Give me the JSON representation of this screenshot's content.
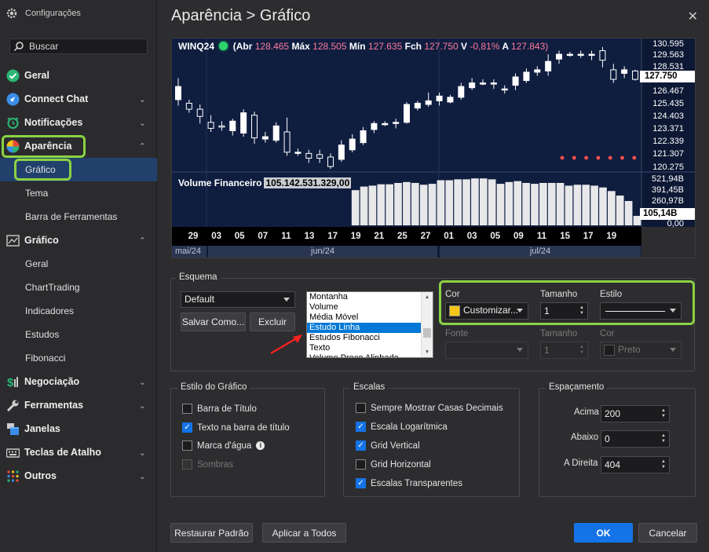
{
  "sidebar": {
    "header": "Configurações",
    "search_placeholder": "Buscar",
    "items": [
      {
        "label": "Geral",
        "icon": "check-circle-icon",
        "expandable": false
      },
      {
        "label": "Connect Chat",
        "icon": "chat-icon",
        "expandable": true
      },
      {
        "label": "Notificações",
        "icon": "alarm-icon",
        "expandable": true
      },
      {
        "label": "Aparência",
        "icon": "palette-icon",
        "expandable": true,
        "expanded": true
      },
      {
        "label": "Gráfico",
        "icon": "chart-icon",
        "expandable": true,
        "expanded": true
      },
      {
        "label": "Negociação",
        "icon": "dollar-icon",
        "expandable": true
      },
      {
        "label": "Ferramentas",
        "icon": "wrench-icon",
        "expandable": true
      },
      {
        "label": "Janelas",
        "icon": "windows-icon",
        "expandable": false
      },
      {
        "label": "Teclas de Atalho",
        "icon": "keyboard-icon",
        "expandable": true
      },
      {
        "label": "Outros",
        "icon": "dots-grid-icon",
        "expandable": true
      }
    ],
    "aparencia_sub": [
      "Gráfico",
      "Tema",
      "Barra de Ferramentas"
    ],
    "grafico_sub": [
      "Geral",
      "ChartTrading",
      "Indicadores",
      "Estudos",
      "Fibonacci"
    ]
  },
  "page": {
    "title": "Aparência > Gráfico"
  },
  "chart": {
    "symbol": "WINQ24",
    "abr_label": "(Abr",
    "abr": "128.465",
    "max_label": "Máx",
    "max": "128.505",
    "min_label": "Mín",
    "min": "127.635",
    "fch_label": "Fch",
    "fch": "127.750",
    "var_label": "V",
    "var": "-0,81%",
    "a_label": "A",
    "a": "127.843)",
    "price_ticks": [
      "130.595",
      "129.563",
      "128.531",
      "126.467",
      "125.435",
      "124.403",
      "123.371",
      "122.339",
      "121.307",
      "120.275"
    ],
    "last_price": "127.750",
    "volume_label": "Volume Financeiro",
    "volume_value": "105.142.531.329,00",
    "volume_ticks": [
      "521,94B",
      "391,45B",
      "260,97B",
      "0,00"
    ],
    "last_volume": "105,14B",
    "x_labels": [
      "29",
      "03",
      "05",
      "07",
      "11",
      "13",
      "17",
      "19",
      "21",
      "25",
      "27",
      "01",
      "03",
      "05",
      "09",
      "11",
      "15",
      "17",
      "19"
    ],
    "months": [
      "mai/24",
      "jun/24",
      "jul/24"
    ],
    "colors": {
      "background": "#0e1a36",
      "candle": "#ffffff",
      "volume": "#e8e8ea",
      "marker": "#ff4d4d"
    }
  },
  "chart_data": {
    "type": "candlestick",
    "title": "WINQ24",
    "candles": [
      {
        "o": 126.0,
        "c": 127.1,
        "h": 127.8,
        "l": 125.5
      },
      {
        "o": 125.7,
        "c": 125.2,
        "h": 126.0,
        "l": 124.9
      },
      {
        "o": 125.2,
        "c": 124.6,
        "h": 125.6,
        "l": 124.0
      },
      {
        "o": 124.1,
        "c": 123.6,
        "h": 124.7,
        "l": 123.3
      },
      {
        "o": 123.8,
        "c": 123.7,
        "h": 124.2,
        "l": 123.4
      },
      {
        "o": 123.4,
        "c": 124.2,
        "h": 124.4,
        "l": 123.0
      },
      {
        "o": 123.2,
        "c": 124.9,
        "h": 125.2,
        "l": 122.9
      },
      {
        "o": 124.7,
        "c": 122.8,
        "h": 125.0,
        "l": 122.3
      },
      {
        "o": 122.7,
        "c": 122.9,
        "h": 123.3,
        "l": 122.4
      },
      {
        "o": 122.6,
        "c": 123.8,
        "h": 124.1,
        "l": 122.4
      },
      {
        "o": 123.3,
        "c": 121.6,
        "h": 124.5,
        "l": 121.3
      },
      {
        "o": 121.6,
        "c": 121.6,
        "h": 121.9,
        "l": 121.3
      },
      {
        "o": 121.5,
        "c": 121.1,
        "h": 121.8,
        "l": 120.7
      },
      {
        "o": 121.4,
        "c": 121.1,
        "h": 121.8,
        "l": 120.7
      },
      {
        "o": 121.2,
        "c": 120.4,
        "h": 121.5,
        "l": 120.2
      },
      {
        "o": 121.0,
        "c": 122.2,
        "h": 122.6,
        "l": 120.8
      },
      {
        "o": 121.8,
        "c": 122.7,
        "h": 123.1,
        "l": 121.6
      },
      {
        "o": 122.4,
        "c": 123.4,
        "h": 123.7,
        "l": 122.2
      },
      {
        "o": 123.5,
        "c": 124.0,
        "h": 124.2,
        "l": 123.2
      },
      {
        "o": 124.0,
        "c": 124.0,
        "h": 124.2,
        "l": 123.8
      },
      {
        "o": 124.0,
        "c": 124.1,
        "h": 124.4,
        "l": 123.6
      },
      {
        "o": 124.1,
        "c": 125.6,
        "h": 125.8,
        "l": 124.0
      },
      {
        "o": 125.3,
        "c": 125.7,
        "h": 125.9,
        "l": 125.1
      },
      {
        "o": 125.6,
        "c": 125.9,
        "h": 126.6,
        "l": 125.4
      },
      {
        "o": 125.9,
        "c": 126.3,
        "h": 126.6,
        "l": 125.5
      },
      {
        "o": 125.8,
        "c": 126.2,
        "h": 126.4,
        "l": 125.7
      },
      {
        "o": 126.2,
        "c": 127.1,
        "h": 127.4,
        "l": 126.0
      },
      {
        "o": 127.0,
        "c": 127.4,
        "h": 127.8,
        "l": 126.8
      },
      {
        "o": 127.3,
        "c": 127.4,
        "h": 127.7,
        "l": 127.2
      },
      {
        "o": 127.3,
        "c": 127.4,
        "h": 127.7,
        "l": 126.9
      },
      {
        "o": 126.9,
        "c": 126.9,
        "h": 127.2,
        "l": 126.5
      },
      {
        "o": 127.2,
        "c": 127.9,
        "h": 128.2,
        "l": 126.8
      },
      {
        "o": 127.6,
        "c": 128.3,
        "h": 128.6,
        "l": 127.4
      },
      {
        "o": 128.3,
        "c": 128.5,
        "h": 128.8,
        "l": 128.0
      },
      {
        "o": 128.4,
        "c": 129.2,
        "h": 129.8,
        "l": 128.0
      },
      {
        "o": 129.4,
        "c": 129.8,
        "h": 130.1,
        "l": 129.0
      },
      {
        "o": 129.8,
        "c": 129.8,
        "h": 130.0,
        "l": 129.6
      },
      {
        "o": 129.8,
        "c": 129.8,
        "h": 130.1,
        "l": 129.5
      },
      {
        "o": 129.8,
        "c": 129.8,
        "h": 130.1,
        "l": 129.3
      },
      {
        "o": 130.1,
        "c": 129.3,
        "h": 130.4,
        "l": 128.7
      },
      {
        "o": 128.5,
        "c": 127.7,
        "h": 129.0,
        "l": 127.4
      },
      {
        "o": 128.2,
        "c": 128.5,
        "h": 128.8,
        "l": 127.8
      },
      {
        "o": 128.4,
        "c": 127.7,
        "h": 128.5,
        "l": 127.6
      }
    ],
    "volume_billions": [
      0,
      0,
      0,
      0,
      0,
      0,
      0,
      0,
      0,
      0,
      0,
      0,
      0,
      0,
      0,
      0,
      0,
      0,
      0,
      0,
      0,
      390,
      430,
      440,
      455,
      455,
      470,
      480,
      470,
      450,
      460,
      500,
      500,
      510,
      510,
      520,
      520,
      510,
      460,
      480,
      490,
      470,
      460,
      470,
      470,
      470,
      440,
      450,
      450,
      440,
      420,
      380,
      330,
      270,
      105
    ],
    "ylim": [
      120.275,
      130.595
    ],
    "volume_ylim": [
      0,
      521.94
    ],
    "price_ticks": [
      130.595,
      129.563,
      128.531,
      127.75,
      126.467,
      125.435,
      124.403,
      123.371,
      122.339,
      121.307,
      120.275
    ],
    "grid": false
  },
  "esquema": {
    "legend": "Esquema",
    "scheme_value": "Default",
    "save_as": "Salvar Como...",
    "delete": "Excluir",
    "list": [
      "Montanha",
      "Volume",
      "Média Móvel",
      "Estudo Linha",
      "Estudos Fibonacci",
      "Texto",
      "Volume Preço Alinhado"
    ],
    "selected_index": 3,
    "cor_label": "Cor",
    "cor_value": "Customizar...",
    "cor_swatch": "#f5c518",
    "tamanho_label": "Tamanho",
    "tamanho_value": "1",
    "estilo_label": "Estilo",
    "fonte_label": "Fonte",
    "tamanho2_label": "Tamanho",
    "tamanho2_value": "1",
    "cor2_label": "Cor",
    "cor2_value": "Preto"
  },
  "estilo": {
    "legend": "Estilo do Gráfico",
    "options": [
      {
        "label": "Barra de Título",
        "checked": false,
        "disabled": false
      },
      {
        "label": "Texto na barra de título",
        "checked": true,
        "disabled": false
      },
      {
        "label": "Marca d'água",
        "checked": false,
        "disabled": false
      },
      {
        "label": "Sombras",
        "checked": false,
        "disabled": true
      }
    ]
  },
  "escalas": {
    "legend": "Escalas",
    "options": [
      {
        "label": "Sempre Mostrar Casas Decimais",
        "checked": false
      },
      {
        "label": "Escala Logarítmica",
        "checked": true
      },
      {
        "label": "Grid Vertical",
        "checked": true
      },
      {
        "label": "Grid Horizontal",
        "checked": false
      },
      {
        "label": "Escalas Transparentes",
        "checked": true
      }
    ]
  },
  "espacamento": {
    "legend": "Espaçamento",
    "acima_label": "Acima",
    "acima": "200",
    "abaixo_label": "Abaixo",
    "abaixo": "0",
    "direita_label": "A Direita",
    "direita": "404"
  },
  "footer": {
    "restore": "Restaurar Padrão",
    "apply_all": "Aplicar a Todos",
    "ok": "OK",
    "cancel": "Cancelar"
  }
}
